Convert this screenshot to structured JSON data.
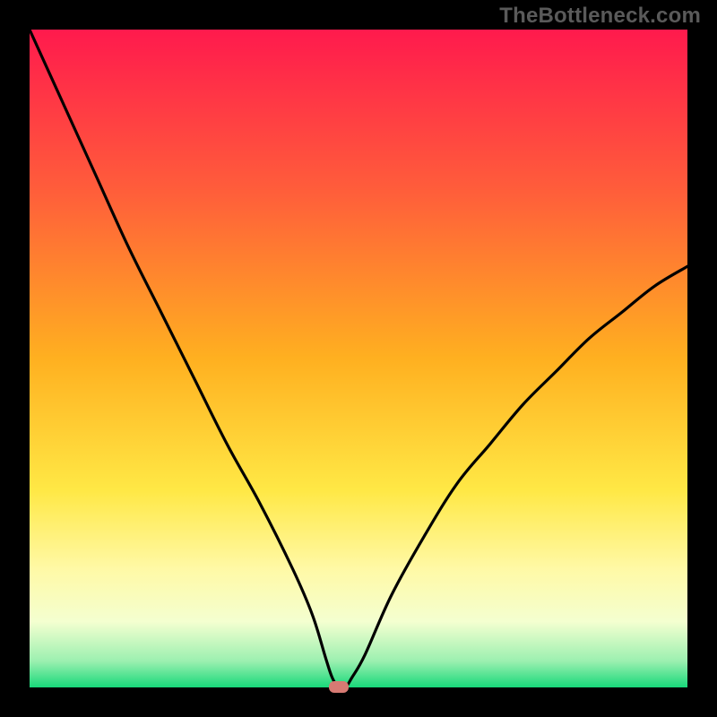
{
  "watermark": "TheBottleneck.com",
  "chart_data": {
    "type": "line",
    "title": "",
    "xlabel": "",
    "ylabel": "",
    "xlim": [
      0,
      100
    ],
    "ylim": [
      0,
      100
    ],
    "grid": false,
    "legend": false,
    "annotations": [],
    "background_gradient": {
      "stops": [
        {
          "offset": 0.0,
          "color": "#ff1a4d"
        },
        {
          "offset": 0.25,
          "color": "#ff5f3a"
        },
        {
          "offset": 0.5,
          "color": "#ffb020"
        },
        {
          "offset": 0.7,
          "color": "#ffe845"
        },
        {
          "offset": 0.82,
          "color": "#fff9a6"
        },
        {
          "offset": 0.9,
          "color": "#f4ffd0"
        },
        {
          "offset": 0.96,
          "color": "#9cf0b0"
        },
        {
          "offset": 1.0,
          "color": "#18d87a"
        }
      ]
    },
    "optimum_marker": {
      "x": 47,
      "y": 0,
      "color": "#d77a73"
    },
    "series": [
      {
        "name": "bottleneck-curve",
        "x": [
          0.0,
          5.0,
          10.0,
          15.0,
          20.0,
          25.0,
          30.0,
          35.0,
          40.0,
          43.0,
          45.0,
          46.0,
          47.0,
          48.0,
          49.0,
          51.0,
          55.0,
          60.0,
          65.0,
          70.0,
          75.0,
          80.0,
          85.0,
          90.0,
          95.0,
          100.0
        ],
        "values": [
          100.0,
          89.0,
          78.0,
          67.0,
          57.0,
          47.0,
          37.0,
          28.0,
          18.0,
          11.0,
          4.5,
          1.5,
          0.0,
          0.0,
          1.5,
          5.0,
          14.0,
          23.0,
          31.0,
          37.0,
          43.0,
          48.0,
          53.0,
          57.0,
          61.0,
          64.0
        ]
      }
    ]
  }
}
